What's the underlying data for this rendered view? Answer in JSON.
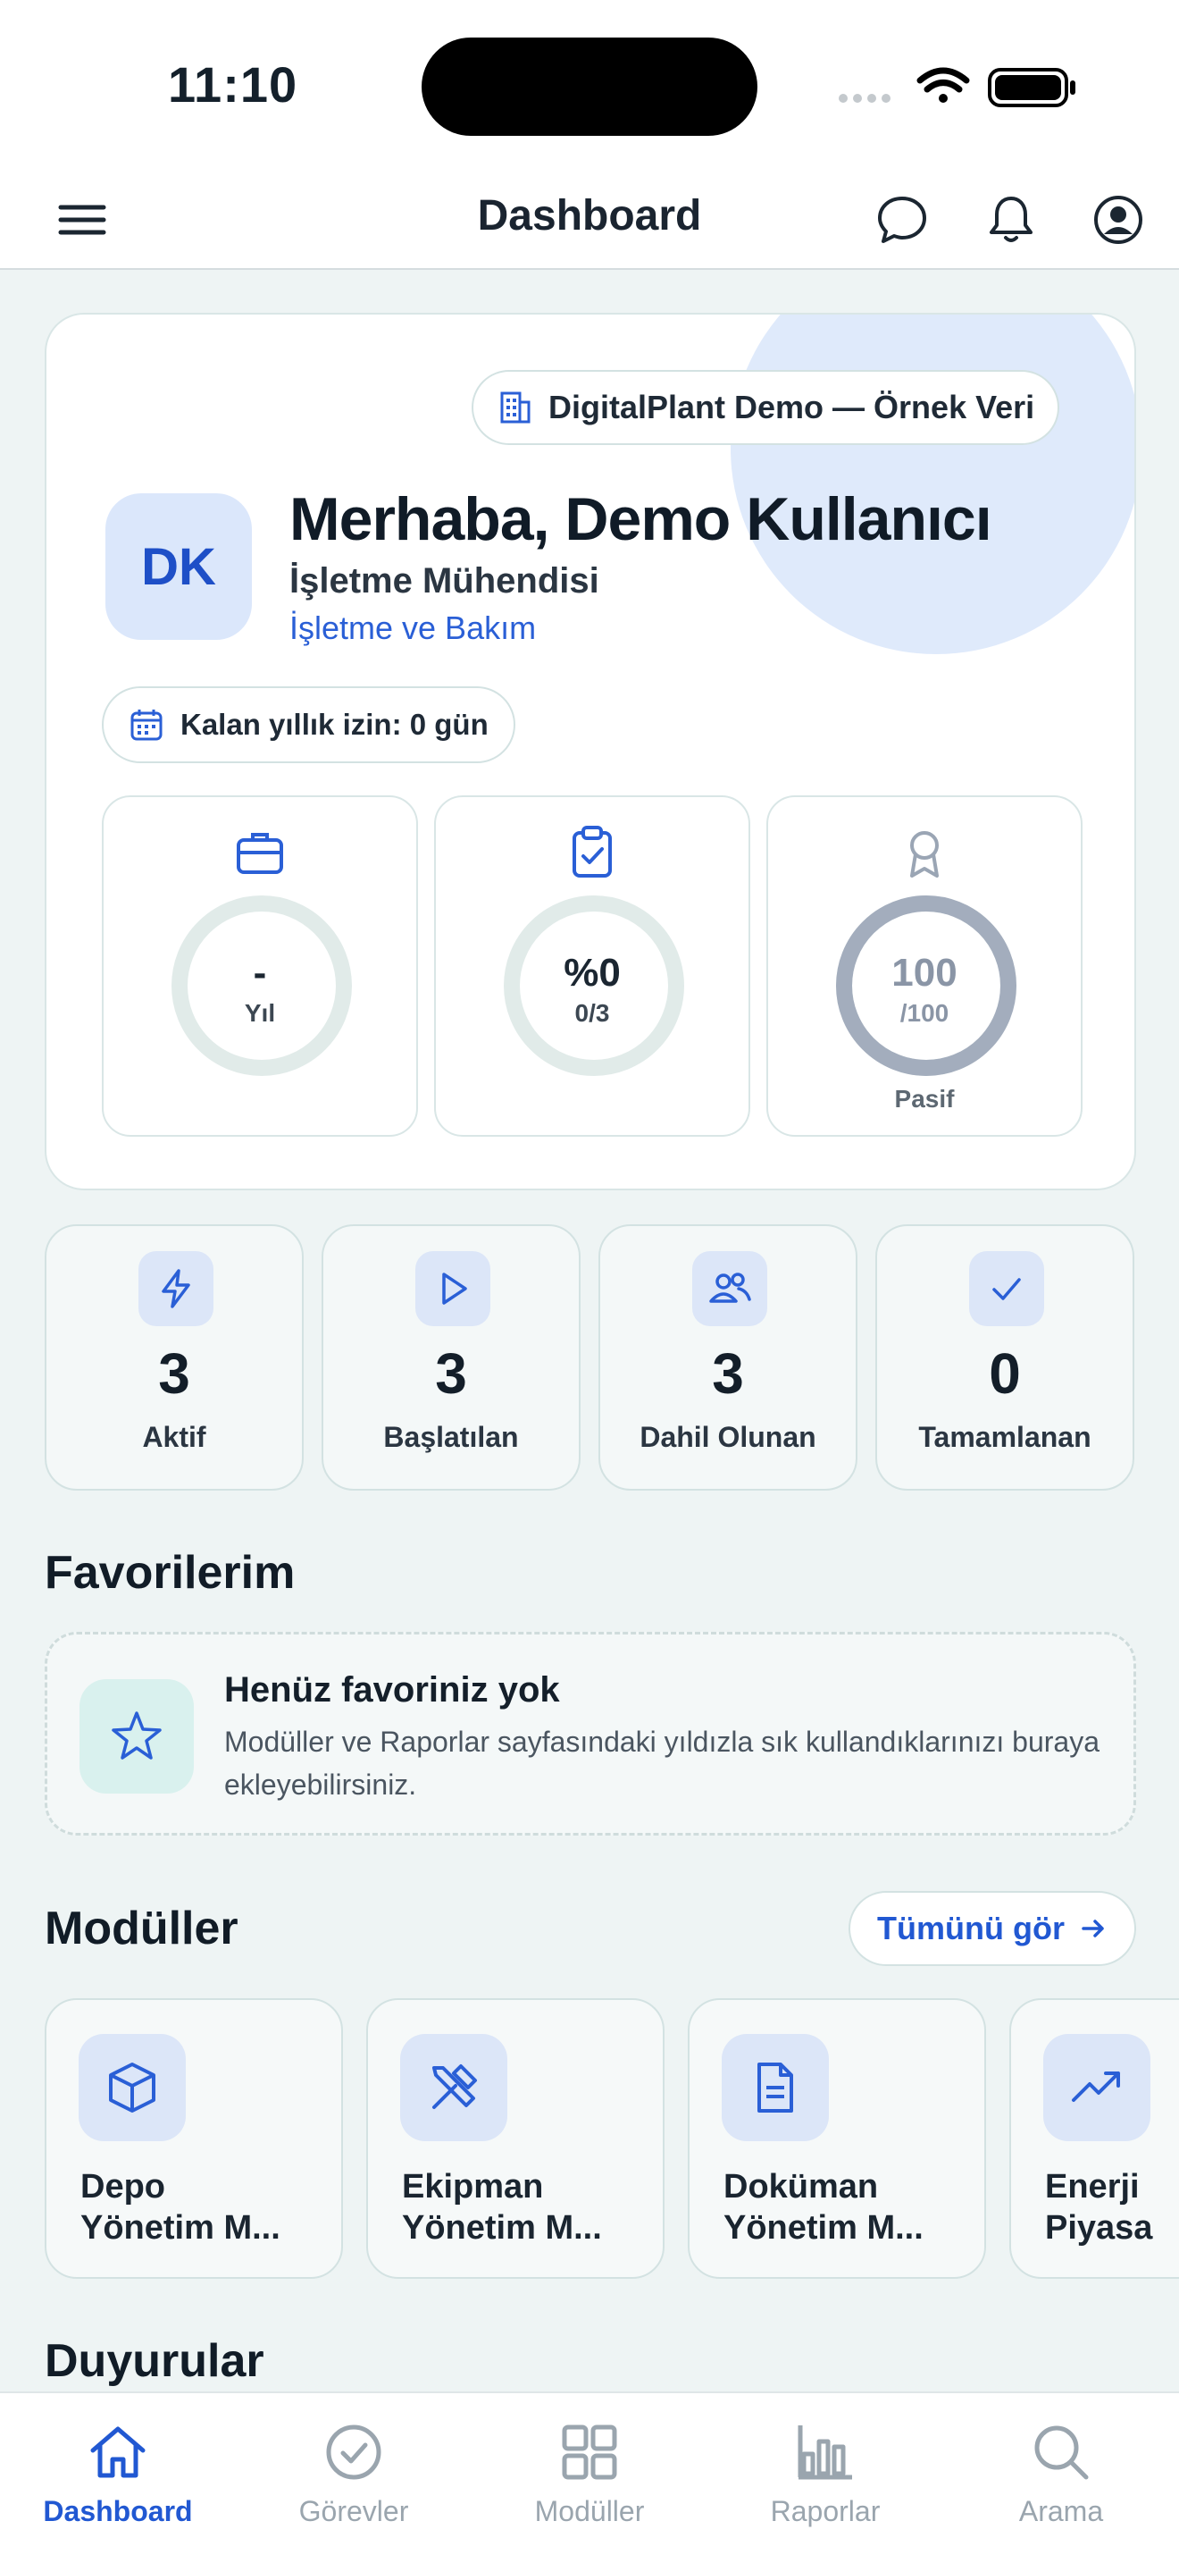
{
  "status_bar": {
    "time": "11:10"
  },
  "header": {
    "title": "Dashboard"
  },
  "hero": {
    "org_badge": "DigitalPlant Demo — Örnek Veri",
    "avatar_initials": "DK",
    "greeting": "Merhaba, Demo Kullanıcı",
    "role": "İşletme Mühendisi",
    "department": "İşletme ve Bakım",
    "leave": "Kalan yıllık izin: 0 gün",
    "stats": [
      {
        "icon": "briefcase-icon",
        "value": "-",
        "sub": "Yıl",
        "footer": ""
      },
      {
        "icon": "clipboard-check-icon",
        "value": "%0",
        "sub": "0/3",
        "footer": ""
      },
      {
        "icon": "award-icon",
        "value": "100",
        "sub": "/100",
        "footer": "Pasif",
        "level": 1.0
      }
    ]
  },
  "metrics": [
    {
      "icon": "bolt-icon",
      "value": "3",
      "label": "Aktif"
    },
    {
      "icon": "play-icon",
      "value": "3",
      "label": "Başlatılan"
    },
    {
      "icon": "users-icon",
      "value": "3",
      "label": "Dahil Olunan"
    },
    {
      "icon": "check-icon",
      "value": "0",
      "label": "Tamamlanan"
    }
  ],
  "favorites": {
    "title": "Favorilerim",
    "empty_title": "Henüz favoriniz yok",
    "empty_text": "Modüller ve Raporlar sayfasındaki yıldızla sık kullandıklarınızı buraya ekleyebilirsiniz."
  },
  "modules": {
    "title": "Modüller",
    "see_all": "Tümünü gör",
    "items": [
      {
        "icon": "box-icon",
        "name": "Depo\nYönetim M..."
      },
      {
        "icon": "tools-icon",
        "name": "Ekipman\nYönetim M..."
      },
      {
        "icon": "document-icon",
        "name": "Doküman\nYönetim M..."
      },
      {
        "icon": "trend-up-icon",
        "name": "Enerji\nPiyasa"
      }
    ]
  },
  "announcements": {
    "title": "Duyurular"
  },
  "tabs": [
    {
      "label": "Dashboard",
      "icon": "home-icon",
      "active": true
    },
    {
      "label": "Görevler",
      "icon": "check-circle-icon"
    },
    {
      "label": "Modüller",
      "icon": "grid-icon"
    },
    {
      "label": "Raporlar",
      "icon": "bar-chart-icon"
    },
    {
      "label": "Arama",
      "icon": "search-icon"
    }
  ],
  "colors": {
    "accent": "#2158d2",
    "background": "#eef4f4",
    "card": "#ffffff",
    "icon_bg": "#dce6f8"
  }
}
